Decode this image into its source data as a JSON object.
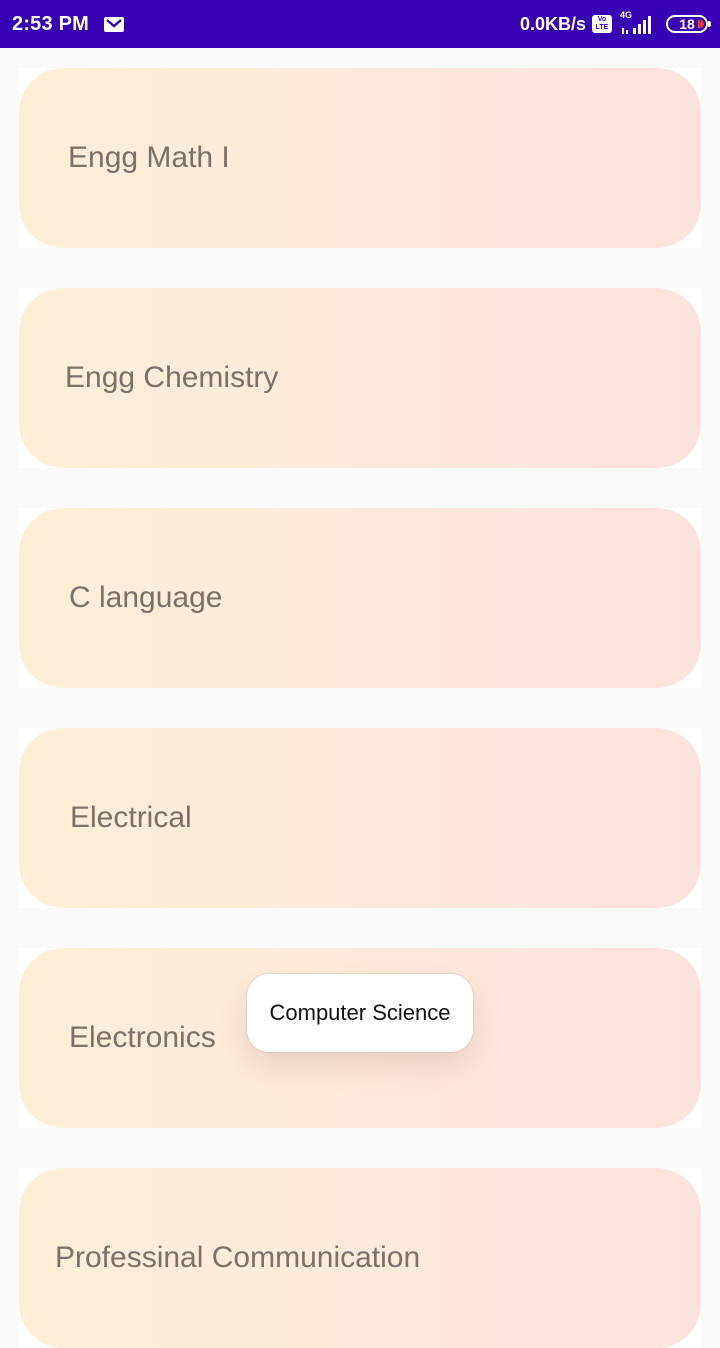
{
  "status_bar": {
    "time": "2:53 PM",
    "icons": [
      "mail-icon",
      "volte-icon",
      "signal-4g-icon",
      "battery-icon"
    ],
    "network_speed": "0.0KB/s",
    "volte_top": "Vo",
    "volte_bottom": "LTE",
    "network_type": "4G",
    "battery_level": "18",
    "background_color": "#3700b3"
  },
  "subjects": [
    {
      "label": "Engg Math I"
    },
    {
      "label": "Engg Chemistry"
    },
    {
      "label": "C language"
    },
    {
      "label": "Electrical"
    },
    {
      "label": "Electronics"
    },
    {
      "label": "Professinal Communication"
    }
  ],
  "toast": {
    "text": "Computer Science"
  },
  "colors": {
    "card_gradient_start": "#fdeed8",
    "card_gradient_end": "#fde3df",
    "card_text": "#7a7169",
    "page_background": "#f9f9f9"
  }
}
